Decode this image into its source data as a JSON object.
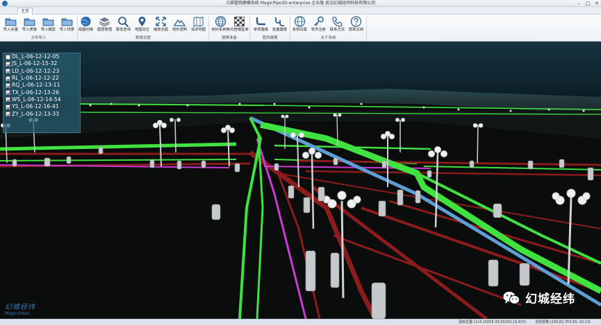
{
  "window": {
    "title": "三维管网建模系统 MagicPipe3D-enterprise 企业版        武汉幻城经纬科技有限公司",
    "min": "–",
    "max": "□",
    "close": "✕"
  },
  "ribbon": {
    "tab": "主页",
    "buttons": [
      {
        "label": "导入矢量",
        "icon": "folder-icon"
      },
      {
        "label": "导入表格",
        "icon": "folder-icon"
      },
      {
        "label": "导入模型",
        "icon": "folder-icon"
      },
      {
        "label": "导入场景",
        "icon": "folder-icon"
      },
      {
        "label": "视图切换",
        "icon": "globe-icon"
      },
      {
        "label": "图层管理",
        "icon": "layers-icon"
      },
      {
        "label": "属性查询",
        "icon": "magnifier-icon"
      },
      {
        "label": "地图定位",
        "icon": "map-pin-icon"
      },
      {
        "label": "缩放全图",
        "icon": "expand-icon"
      },
      {
        "label": "地形透明",
        "icon": "terrain-icon"
      },
      {
        "label": "请求地图",
        "icon": "map-icon"
      },
      {
        "label": "坐标系转换",
        "icon": "globe-grid-icon"
      },
      {
        "label": "托管模型库",
        "icon": "checker-icon"
      },
      {
        "label": "单项建模",
        "icon": "pipe-icon"
      },
      {
        "label": "批量建模",
        "icon": "pipes-icon"
      },
      {
        "label": "系统设置",
        "icon": "globe-icon"
      },
      {
        "label": "软件注册",
        "icon": "key-icon"
      },
      {
        "label": "联系方式",
        "icon": "phone-icon"
      },
      {
        "label": "帮助文档",
        "icon": "help-icon"
      }
    ],
    "groups": [
      "文件导入",
      "数据设置",
      "建模准备",
      "管网建模",
      "关于系统"
    ]
  },
  "layers": [
    {
      "label": "DL_L-06-12-12-05",
      "checked": false
    },
    {
      "label": "JS_L-06-12-15-32",
      "checked": true
    },
    {
      "label": "LD_L-06-12-12-23",
      "checked": true
    },
    {
      "label": "RL_L-06-12-12-22",
      "checked": true
    },
    {
      "label": "RQ_L-06-12-13-11",
      "checked": true
    },
    {
      "label": "TX_L-06-12-13-26",
      "checked": true
    },
    {
      "label": "WS_L-06-12-14-54",
      "checked": true
    },
    {
      "label": "YS_L-06-12-16-41",
      "checked": true
    },
    {
      "label": "ZY_L-06-12-13-33",
      "checked": true
    }
  ],
  "status": {
    "position": "鼠标位置:(114.15056,30.50293,19.933)",
    "camera": "当前视角:(259.82,359.83,-10.13)"
  },
  "watermark": {
    "brand_cn": "幻城经纬",
    "brand_en": "MagicUrban",
    "wechat": "幻城经纬"
  },
  "colors": {
    "green_pipe": "#3fe23f",
    "red_pipe": "#8a1c1c",
    "magenta_pipe": "#c93ad6",
    "blue_pipe": "#5b9fd6",
    "sky": "#102833",
    "ground": "#0c0d0d"
  }
}
